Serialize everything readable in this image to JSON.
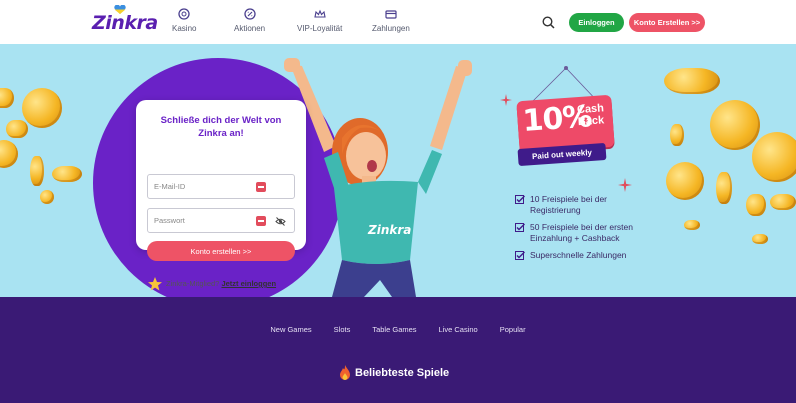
{
  "header": {
    "logo_text": "Zinkra",
    "nav": [
      {
        "label": "Kasino",
        "icon": "casino-chip-icon"
      },
      {
        "label": "Aktionen",
        "icon": "promotions-icon"
      },
      {
        "label": "VIP-Loyalität",
        "icon": "vip-crown-icon"
      },
      {
        "label": "Zahlungen",
        "icon": "payments-icon"
      }
    ],
    "login_label": "Einloggen",
    "create_account_label": "Konto Erstellen >>"
  },
  "signup": {
    "title": "Schließe dich der Welt von Zinkra an!",
    "email_placeholder": "E-Mail-ID",
    "password_placeholder": "Passwort",
    "submit_label": "Konto erstellen >>",
    "member_text": "Zinkra-Mitglied?",
    "member_link": "Jetzt einloggen"
  },
  "promo": {
    "percent": "10%",
    "cash": "Cash",
    "back": "Back",
    "paid_label": "Paid out weekly",
    "benefits": [
      "10 Freispiele bei der Registrierung",
      "50 Freispiele bei der ersten Einzahlung + Cashback",
      "Superschnelle Zahlungen"
    ]
  },
  "categories": [
    "New Games",
    "Slots",
    "Table Games",
    "Live Casino",
    "Popular"
  ],
  "popular_title": "Beliebteste Spiele",
  "colors": {
    "brand_purple": "#6a22c7",
    "login_green": "#21a645",
    "cta_red": "#ee5366",
    "hero_bg": "#a9e3f2",
    "footer_purple": "#3a1a75"
  }
}
